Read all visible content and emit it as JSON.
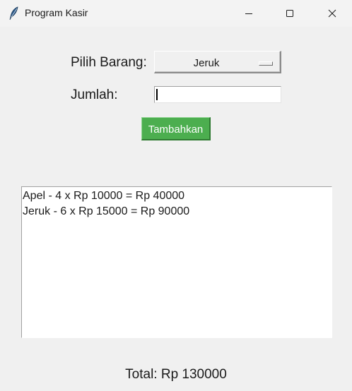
{
  "window": {
    "title": "Program Kasir",
    "icon": "feather-icon",
    "controls": [
      "minimize-icon",
      "maximize-icon",
      "close-icon"
    ]
  },
  "form": {
    "item_label": "Pilih Barang:",
    "item_selected": "Jeruk",
    "quantity_label": "Jumlah:",
    "quantity_value": "",
    "add_button_label": "Tambahkan",
    "add_button_color": "#4cae4f"
  },
  "cart": {
    "items": [
      "Apel - 4 x Rp 10000 = Rp 40000",
      "Jeruk - 6 x Rp 15000 = Rp 90000"
    ]
  },
  "summary": {
    "total_text": "Total: Rp 130000"
  }
}
